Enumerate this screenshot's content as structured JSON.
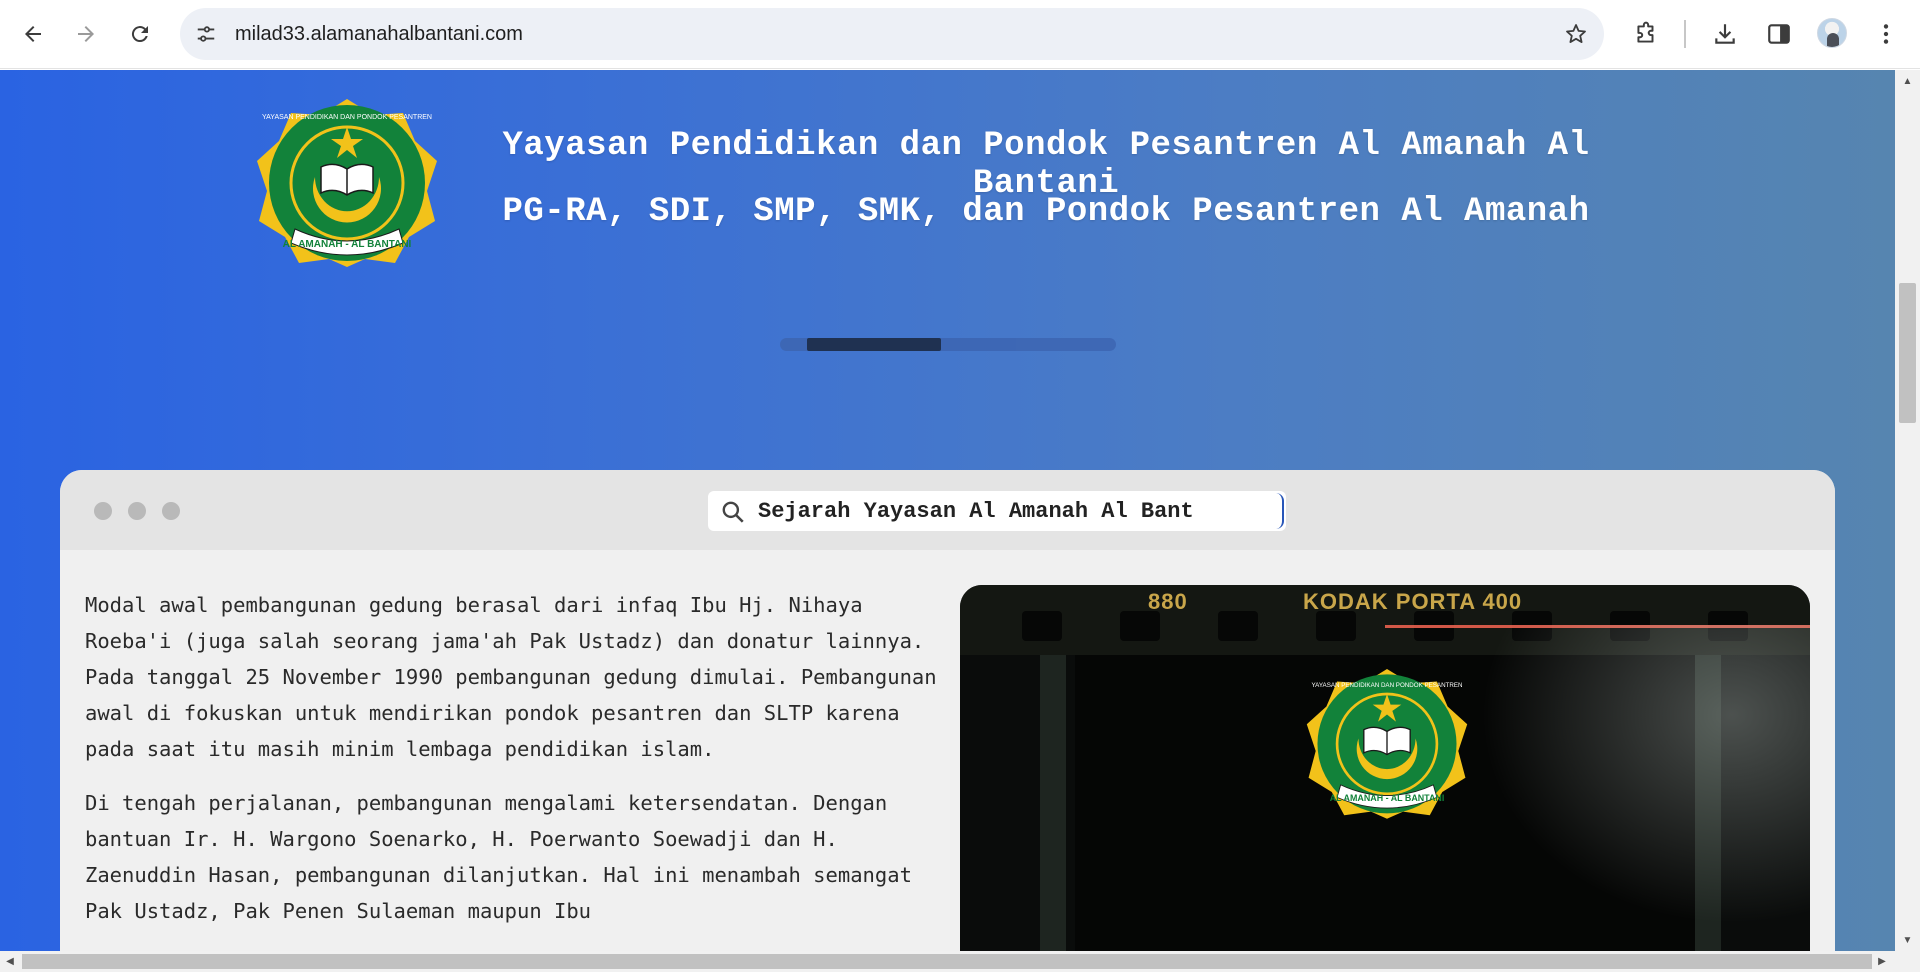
{
  "browser": {
    "url": "milad33.alamanahalbantani.com",
    "icons": {
      "back": "arrow-left-icon",
      "forward": "arrow-right-icon",
      "reload": "reload-icon",
      "site_info": "tune-icon",
      "bookmark": "star-icon",
      "extensions": "puzzle-icon",
      "downloads": "download-icon",
      "side_panel": "side-panel-icon",
      "menu": "kebab-menu-icon"
    }
  },
  "header": {
    "title": "Yayasan Pendidikan dan Pondok Pesantren Al Amanah Al Bantani",
    "subtitle": "PG-RA, SDI, SMP, SMK, dan Pondok Pesantren Al Amanah",
    "logo_text_top": "YAYASAN PENDIDIKAN DAN PONDOK PESANTREN",
    "logo_text_bottom": "AL AMANAH - AL BANTANI",
    "slider_progress": 0.4
  },
  "card": {
    "search_value": "Sejarah Yayasan Al Amanah Al Bant",
    "paragraphs": [
      "Modal awal pembangunan gedung berasal dari infaq Ibu Hj. Nihaya Roeba'i (juga salah seorang jama'ah Pak Ustadz) dan donatur lainnya. Pada tanggal 25 November 1990 pembangunan gedung dimulai. Pembangunan awal di fokuskan untuk mendirikan pondok pesantren dan SLTP karena pada saat itu masih minim lembaga pendidikan islam.",
      "Di tengah perjalanan, pembangunan mengalami ketersendatan. Dengan bantuan Ir. H. Wargono Soenarko, H. Poerwanto Soewadji dan H. Zaenuddin Hasan, pembangunan dilanjutkan. Hal ini menambah semangat Pak Ustadz, Pak Penen Sulaeman maupun Ibu"
    ],
    "photo": {
      "film_number": "880",
      "film_brand": "KODAK PORTA 400"
    }
  },
  "colors": {
    "gradient_start": "#2a63e2",
    "gradient_end": "#5685b0",
    "logo_green": "#12823a",
    "logo_gold": "#f2c21a"
  }
}
